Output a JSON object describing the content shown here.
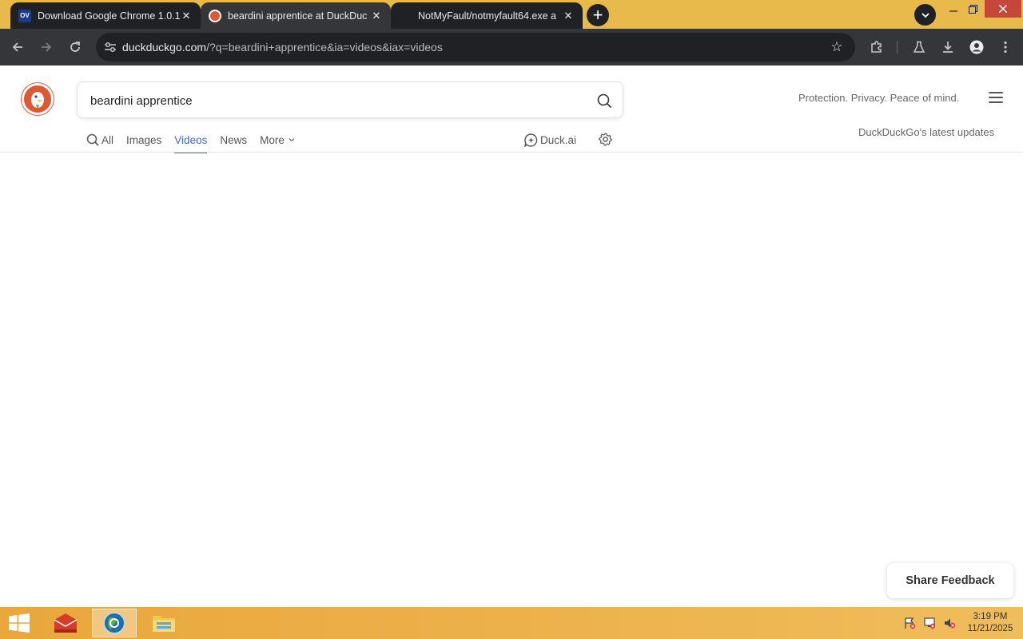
{
  "browser": {
    "tabs": [
      {
        "title": "Download Google Chrome 1.0.1",
        "favicon": "ov-favicon",
        "active": false
      },
      {
        "title": "beardini apprentice at DuckDuc",
        "favicon": "duckduckgo-favicon",
        "active": true
      },
      {
        "title": "NotMyFault/notmyfault64.exe a",
        "favicon": "none",
        "active": false
      }
    ],
    "address_host": "duckduckgo.com",
    "address_path": "/?q=beardini+apprentice&ia=videos&iax=videos",
    "accent": "#35363a"
  },
  "ddg": {
    "query": "beardini apprentice",
    "tagline": "Protection. Privacy. Peace of mind.",
    "nav": {
      "all": "All",
      "images": "Images",
      "videos": "Videos",
      "news": "News",
      "more": "More"
    },
    "active_tab": "Videos",
    "duckai": "Duck.ai",
    "updates": "DuckDuckGo's latest updates",
    "feedback": "Share Feedback",
    "brand_color": "#de5833",
    "link_color": "#3969ef"
  },
  "taskbar": {
    "time": "3:19 PM",
    "date": "11/21/2025"
  }
}
